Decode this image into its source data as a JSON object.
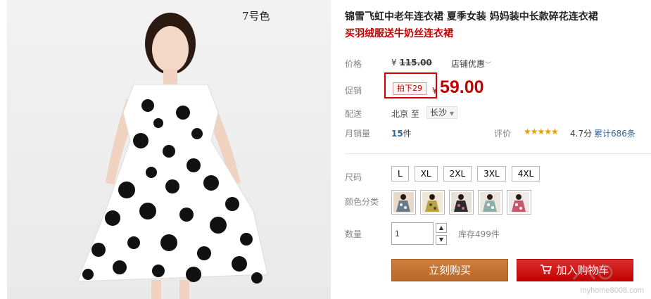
{
  "product": {
    "photo_label": "7号色",
    "title": "锦雪飞虹中老年连衣裙 夏季女装 妈妈装中长款碎花连衣裙",
    "subtitle": "买羽绒服送牛奶丝连衣裙"
  },
  "price": {
    "label": "价格",
    "currency": "¥",
    "original": "115.00",
    "store_discount": "店铺优惠",
    "store_discount_icon": "chevron-down-icon"
  },
  "promo": {
    "label": "促销",
    "tag": "拍下29",
    "currency": "¥",
    "price": "59.00"
  },
  "shipping": {
    "label": "配送",
    "from": "北京 至",
    "to": "长沙",
    "to_icon": "chevron-down-icon"
  },
  "sales": {
    "label": "月销量",
    "count": "15",
    "unit": "件",
    "rating_label": "评价",
    "stars": "★★★★★",
    "score": "4.7分",
    "reviews": "累计686条"
  },
  "size": {
    "label": "尺码",
    "options": [
      "L",
      "XL",
      "2XL",
      "3XL",
      "4XL"
    ]
  },
  "color": {
    "label": "颜色分类",
    "swatch_count": 5
  },
  "quantity": {
    "label": "数量",
    "value": "1",
    "stock": "库存499件"
  },
  "actions": {
    "buy_now": "立刻购买",
    "add_to_cart": "加入购物车"
  },
  "watermark": "myhome8008.com",
  "colors": {
    "accent_red": "#c40000",
    "buy_orange": "#c37633",
    "link_blue": "#336699",
    "star_gold": "#e8a000"
  }
}
